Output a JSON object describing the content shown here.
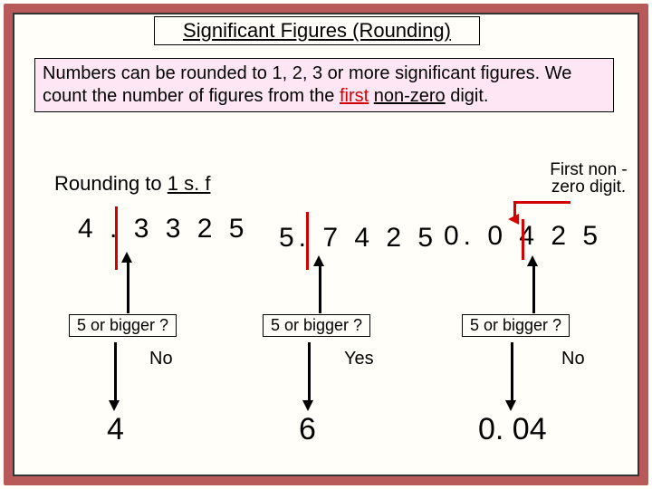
{
  "title": "Significant Figures (Rounding)",
  "intro": {
    "pre": "Numbers can be rounded to 1, 2, 3 or more significant figures. We count the number of figures from the ",
    "first": "first",
    "space": " ",
    "nonzero": "non-zero",
    "post": " digit."
  },
  "subhead": {
    "a": "Rounding to ",
    "b": "1 s. f"
  },
  "numbers": {
    "n1": "4 . 3 3 2 5",
    "n2": "5. 7 4 2 5",
    "n3": "0. 0 4 2 5"
  },
  "callout": "First non -zero digit.",
  "questions": {
    "q": "5 or bigger ?"
  },
  "answers": {
    "a1": "No",
    "a2": "Yes",
    "a3": "No"
  },
  "finals": {
    "f1": "4",
    "f2": "6",
    "f3": "0. 04"
  },
  "colors": {
    "accent": "#d40000",
    "frame": "#b85a5a",
    "introBg": "#ffe6f5"
  }
}
